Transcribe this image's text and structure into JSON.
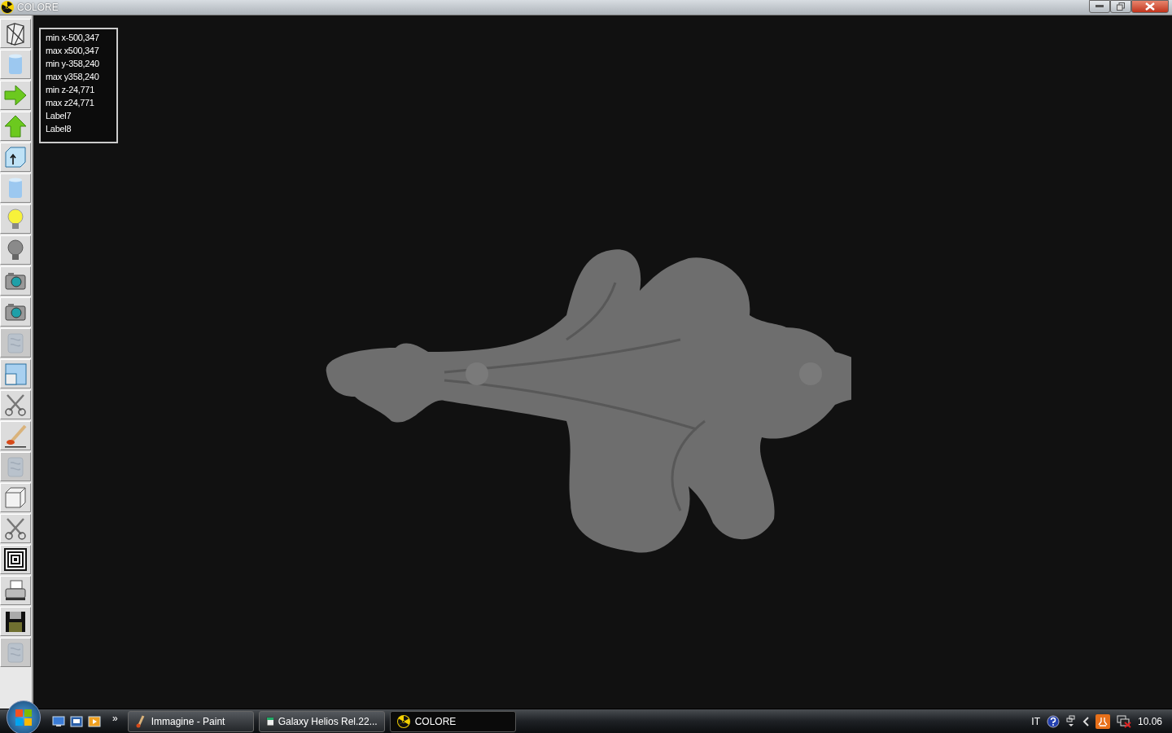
{
  "window": {
    "title": "COLORE",
    "controls": [
      {
        "kind": "minimize"
      },
      {
        "kind": "restore"
      },
      {
        "kind": "close"
      }
    ]
  },
  "toolbar": [
    {
      "kind": "wireframe",
      "disabled": false
    },
    {
      "kind": "cylinder",
      "disabled": false
    },
    {
      "kind": "arrow-right",
      "disabled": false
    },
    {
      "kind": "arrow-up",
      "disabled": false
    },
    {
      "kind": "box-arrow",
      "disabled": false
    },
    {
      "kind": "cylinder",
      "disabled": false
    },
    {
      "kind": "bulb-on",
      "disabled": false
    },
    {
      "kind": "bulb-off",
      "disabled": false
    },
    {
      "kind": "camera",
      "disabled": false
    },
    {
      "kind": "camera",
      "disabled": false
    },
    {
      "kind": "texture",
      "disabled": true
    },
    {
      "kind": "panels",
      "disabled": false
    },
    {
      "kind": "scissors",
      "disabled": false
    },
    {
      "kind": "brush",
      "disabled": false
    },
    {
      "kind": "texture",
      "disabled": true
    },
    {
      "kind": "cube",
      "disabled": false
    },
    {
      "kind": "scissors",
      "disabled": false
    },
    {
      "kind": "squares",
      "disabled": false
    },
    {
      "kind": "printer",
      "disabled": false
    },
    {
      "kind": "floppy",
      "disabled": false
    },
    {
      "kind": "texture",
      "disabled": true
    }
  ],
  "info_lines": [
    "min x-500,347",
    "max x500,347",
    "min y-358,240",
    "max y358,240",
    "min z-24,771",
    "max z24,771",
    "Label7",
    "Label8"
  ],
  "taskbar": {
    "tasks": [
      {
        "label": "Immagine - Paint",
        "kind": "paint",
        "selected": false
      },
      {
        "label": "Galaxy Helios  Rel.22...",
        "kind": "app",
        "selected": false
      },
      {
        "label": "COLORE",
        "kind": "radiation",
        "selected": true
      }
    ],
    "more": "»",
    "language": "IT",
    "clock": "10.06",
    "tray": [
      {
        "kind": "help"
      },
      {
        "kind": "window"
      },
      {
        "kind": "chevron"
      },
      {
        "kind": "app"
      },
      {
        "kind": "network"
      }
    ]
  }
}
